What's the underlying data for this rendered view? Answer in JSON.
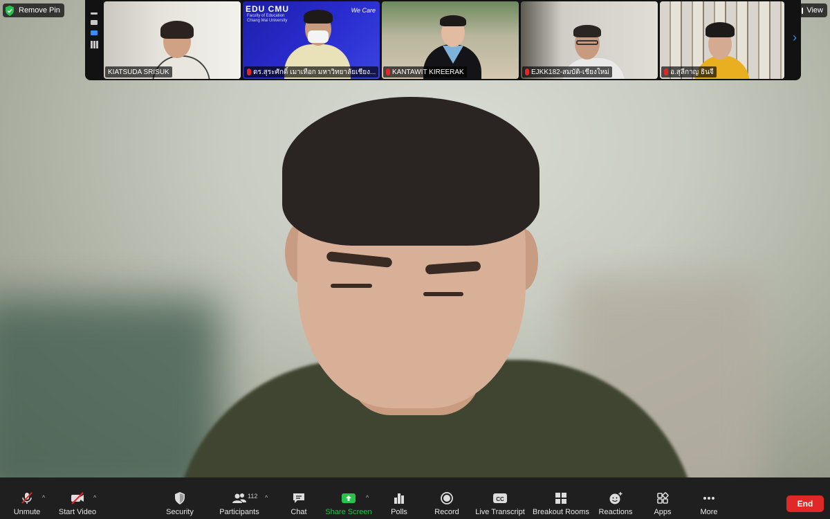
{
  "pin": {
    "label": "Remove Pin"
  },
  "view": {
    "label": "View"
  },
  "gallery": {
    "tiles": [
      {
        "name": "KIATSUDA SRISUK",
        "muted": false
      },
      {
        "name": "ดร.สุระศักดิ์ เมาเทือก มหาวิทยาลัยเชียง...",
        "muted": true,
        "logo": "EDU CMU",
        "logo_sub1": "Faculty of Education",
        "logo_sub2": "Chiang Mai University",
        "logo_right": "We Care"
      },
      {
        "name": "KANTAWIT KIREERAK",
        "muted": true
      },
      {
        "name": "EJKK182-สมบัติ-เชียงใหม่",
        "muted": true
      },
      {
        "name": "อ.สุลีกาญ ธินจี",
        "muted": true
      }
    ]
  },
  "toolbar": {
    "unmute": "Unmute",
    "start_video": "Start Video",
    "security": "Security",
    "participants": "Participants",
    "participants_count": "112",
    "chat": "Chat",
    "share_screen": "Share Screen",
    "polls": "Polls",
    "record": "Record",
    "live_transcript": "Live Transcript",
    "breakout_rooms": "Breakout Rooms",
    "reactions": "Reactions",
    "apps": "Apps",
    "more": "More",
    "end": "End"
  },
  "colors": {
    "accent_green": "#27c24c",
    "end_red": "#e02828",
    "pin_blue": "#3a8cf2"
  }
}
